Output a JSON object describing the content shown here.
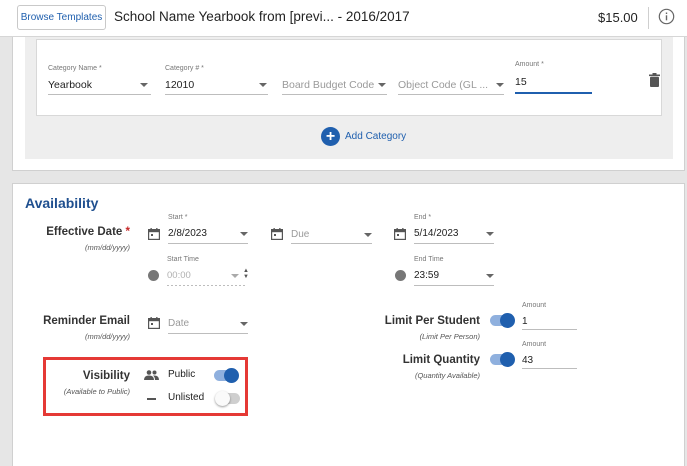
{
  "header": {
    "browse_templates": "Browse Templates",
    "title": "School Name Yearbook from [previ...  - 2016/2017",
    "price": "$15.00",
    "info_icon": "info-icon"
  },
  "category": {
    "category_name_label": "Category Name *",
    "category_name_value": "Yearbook",
    "category_num_label": "Category # *",
    "category_num_value": "12010",
    "board_budget_placeholder": "Board Budget Code",
    "object_code_placeholder": "Object Code (GL ...",
    "amount_label": "Amount *",
    "amount_value": "15",
    "delete_icon": "trash-icon",
    "add_category": "Add Category"
  },
  "availability": {
    "title": "Availability",
    "effective_date": {
      "label": "Effective Date",
      "required": "*",
      "format": "(mm/dd/yyyy)",
      "start_label": "Start *",
      "start_value": "2/8/2023",
      "due_placeholder": "Due",
      "end_label": "End *",
      "end_value": "5/14/2023",
      "start_time_label": "Start Time",
      "start_time_placeholder": "00:00",
      "end_time_label": "End Time",
      "end_time_value": "23:59"
    },
    "reminder_email": {
      "label": "Reminder Email",
      "format": "(mm/dd/yyyy)",
      "date_placeholder": "Date"
    },
    "limit_per_student": {
      "label": "Limit Per Student",
      "sub": "(Limit Per Person)",
      "enabled": true,
      "amount_label": "Amount",
      "amount_value": "1"
    },
    "limit_quantity": {
      "label": "Limit Quantity",
      "sub": "(Quantity Available)",
      "enabled": true,
      "amount_label": "Amount",
      "amount_value": "43"
    },
    "visibility": {
      "label": "Visibility",
      "sub": "(Available to Public)",
      "public_label": "Public",
      "public_on": true,
      "unlisted_label": "Unlisted",
      "unlisted_on": false
    }
  },
  "colors": {
    "accent": "#1f5fae",
    "highlight_box": "#e53935"
  }
}
